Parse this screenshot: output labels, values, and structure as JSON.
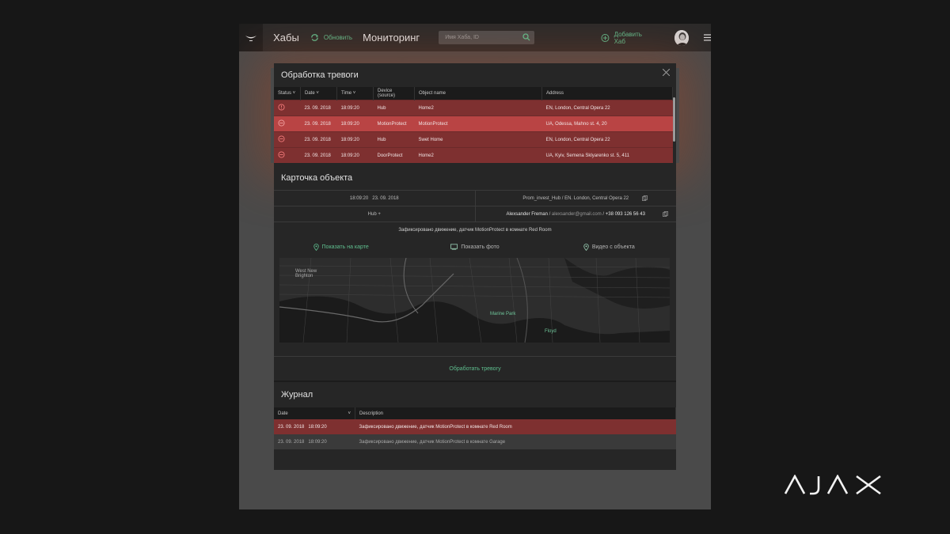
{
  "header": {
    "hubs": "Хабы",
    "refresh": "Обновить",
    "monitoring": "Мониторинг",
    "search_placeholder": "Имя Хаба, ID",
    "add_hub": "Добавить Хаб"
  },
  "alarm_panel": {
    "title": "Обработка тревоги",
    "columns": [
      "Status",
      "Date",
      "Time",
      "Device (source)",
      "Object name",
      "Address"
    ],
    "rows": [
      {
        "date": "23. 09. 2018",
        "time": "18:09:20",
        "device": "Hub",
        "object": "Home2",
        "address": "EN, London, Central Opera 22"
      },
      {
        "date": "23. 09. 2018",
        "time": "18:09:20",
        "device": "MotionProtect",
        "object": "MotionProtect",
        "address": "UA, Odessa, Mahno st. 4, 20"
      },
      {
        "date": "23. 09. 2018",
        "time": "18:09:20",
        "device": "Hub",
        "object": "Swet Home",
        "address": "EN, London, Central Opera 22"
      },
      {
        "date": "23. 09. 2018",
        "time": "18:09:20",
        "device": "DoorProtect",
        "object": "Home2",
        "address": "UA, Kyiv, Semena Sklyarenko st. 5, 411"
      }
    ]
  },
  "object_card": {
    "title": "Карточка объекта",
    "time": "18:09:20",
    "date": "23. 09. 2018",
    "hub_name": "Prom_invest_Hub",
    "address": "EN. London, Central Opera 22",
    "hub_type": "Hub +",
    "owner": "Alexsander Freman",
    "email": "alexsander@gmail.com",
    "phone": "+38 093 126 56 43",
    "event": "Зафиксировано движение, датчик MotionProtect в комнате Red Room",
    "show_map": "Показать на карте",
    "show_photo": "Показать фото",
    "video": "Видео с объекта",
    "process": "Обработать тревогу"
  },
  "map_labels": {
    "west_new_brighton": "West New Brighton",
    "marine_park": "Marine Park",
    "floyd": "Floyd"
  },
  "journal": {
    "title": "Журнал",
    "columns": [
      "Date",
      "Description"
    ],
    "rows": [
      {
        "date": "23. 09. 2018   18:09:20",
        "desc": "Зафиксировано движение, датчик MotionProtect в комнате Red Room"
      },
      {
        "date": "23. 09. 2018   18:09:20",
        "desc": "Зафиксировано движение, датчик MotionProtect в комнате Garage"
      }
    ]
  },
  "brand": "AJAX",
  "colors": {
    "accent": "#5fbf8f",
    "alarm": "#7e3030",
    "alarm_selected": "#b94444",
    "status_icon": "#e86a6a"
  }
}
